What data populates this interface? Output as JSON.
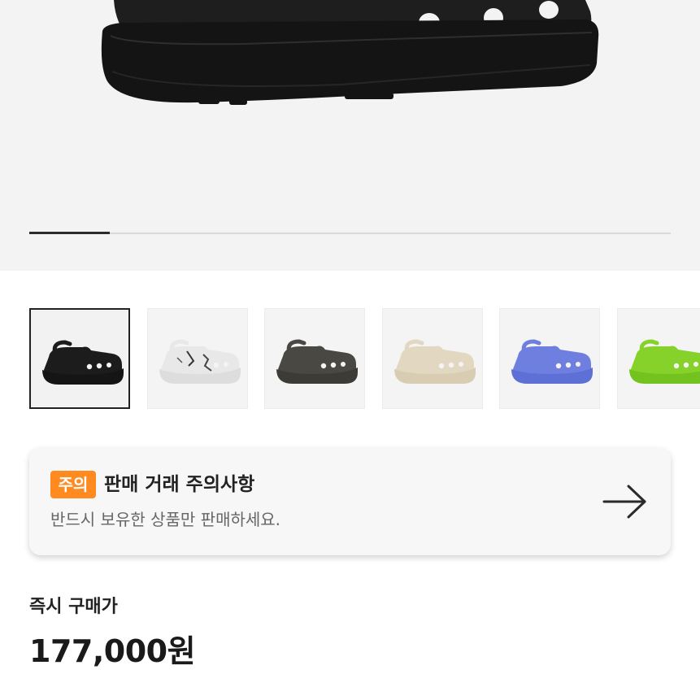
{
  "gallery": {
    "progress": 0.125,
    "thumbnails": [
      {
        "color_name": "black",
        "body": "#1c1c1c",
        "sole": "#151515",
        "selected": true
      },
      {
        "color_name": "marble",
        "body": "#e8e8e8",
        "sole": "#dddddd",
        "selected": false
      },
      {
        "color_name": "dark-grey",
        "body": "#4a4842",
        "sole": "#3d3b36",
        "selected": false
      },
      {
        "color_name": "bone",
        "body": "#e2d7c0",
        "sole": "#d8ccb2",
        "selected": false
      },
      {
        "color_name": "periwinkle",
        "body": "#6f7fe0",
        "sole": "#5e6fd6",
        "selected": false
      },
      {
        "color_name": "lime",
        "body": "#86d22a",
        "sole": "#74c21d",
        "selected": false
      }
    ]
  },
  "notice": {
    "badge": "주의",
    "title": "판매 거래 주의사항",
    "subtitle": "반드시 보유한 상품만 판매하세요.",
    "badge_color": "#ff8a1f",
    "icon": "arrow-right-icon"
  },
  "price": {
    "label": "즉시 구매가",
    "value": "177,000원"
  }
}
